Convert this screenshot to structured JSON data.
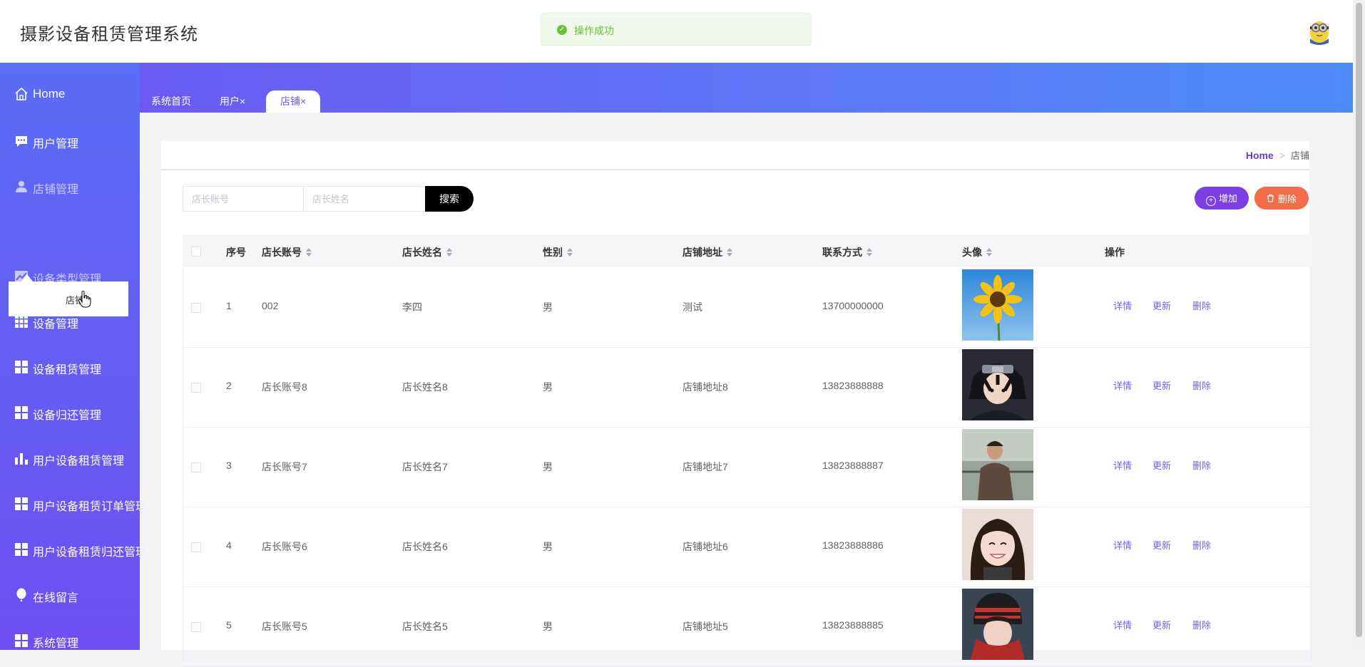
{
  "app": {
    "title": "摄影设备租赁管理系统"
  },
  "toast": {
    "message": "操作成功"
  },
  "sidebar": {
    "items": [
      {
        "label": "Home",
        "icon": "home-icon"
      },
      {
        "label": "用户管理",
        "icon": "chat-icon"
      },
      {
        "label": "店铺管理",
        "icon": "user-icon"
      },
      {
        "label": "设备类型管理",
        "icon": "line-chart-icon"
      },
      {
        "label": "设备管理",
        "icon": "grid-icon"
      },
      {
        "label": "设备租赁管理",
        "icon": "tiles-icon"
      },
      {
        "label": "设备归还管理",
        "icon": "tiles-icon"
      },
      {
        "label": "用户设备租赁管理",
        "icon": "bar-chart-icon"
      },
      {
        "label": "用户设备租赁订单管理",
        "icon": "tiles-icon"
      },
      {
        "label": "用户设备租赁归还管理",
        "icon": "tiles-icon"
      },
      {
        "label": "在线留言",
        "icon": "balloon-icon"
      },
      {
        "label": "系统管理",
        "icon": "tiles-icon"
      }
    ],
    "submenu_item": "店铺"
  },
  "tabs": [
    {
      "label": "系统首页"
    },
    {
      "label": "用户",
      "close": "×"
    },
    {
      "label": "店铺",
      "close": "×"
    }
  ],
  "breadcrumb": {
    "home": "Home",
    "sep": ">",
    "current": "店铺"
  },
  "search": {
    "account_placeholder": "店长账号",
    "name_placeholder": "店长姓名",
    "button": "搜索"
  },
  "actions": {
    "add": "增加",
    "delete": "删除"
  },
  "table": {
    "headers": [
      "序号",
      "店长账号",
      "店长姓名",
      "性别",
      "店铺地址",
      "联系方式",
      "头像",
      "操作"
    ],
    "row_actions": [
      "详情",
      "更新",
      "删除"
    ],
    "rows": [
      {
        "no": "1",
        "account": "002",
        "name": "李四",
        "gender": "男",
        "address": "测试",
        "phone": "13700000000",
        "avatar": "sunflower"
      },
      {
        "no": "2",
        "account": "店长账号8",
        "name": "店长姓名8",
        "gender": "男",
        "address": "店铺地址8",
        "phone": "13823888888",
        "avatar": "anime"
      },
      {
        "no": "3",
        "account": "店长账号7",
        "name": "店长姓名7",
        "gender": "男",
        "address": "店铺地址7",
        "phone": "13823888887",
        "avatar": "man"
      },
      {
        "no": "4",
        "account": "店长账号6",
        "name": "店长姓名6",
        "gender": "男",
        "address": "店铺地址6",
        "phone": "13823888886",
        "avatar": "girl"
      },
      {
        "no": "5",
        "account": "店长账号5",
        "name": "店长姓名5",
        "gender": "男",
        "address": "店铺地址5",
        "phone": "13823888885",
        "avatar": "hat"
      }
    ]
  },
  "colors": {
    "sidebar_top": "#5b6cf6",
    "sidebar_bottom": "#6e4ff2",
    "accent": "#7a5cf0",
    "add_button": "#7b3fe4",
    "delete_button": "#f26d47",
    "success": "#67c23a"
  }
}
